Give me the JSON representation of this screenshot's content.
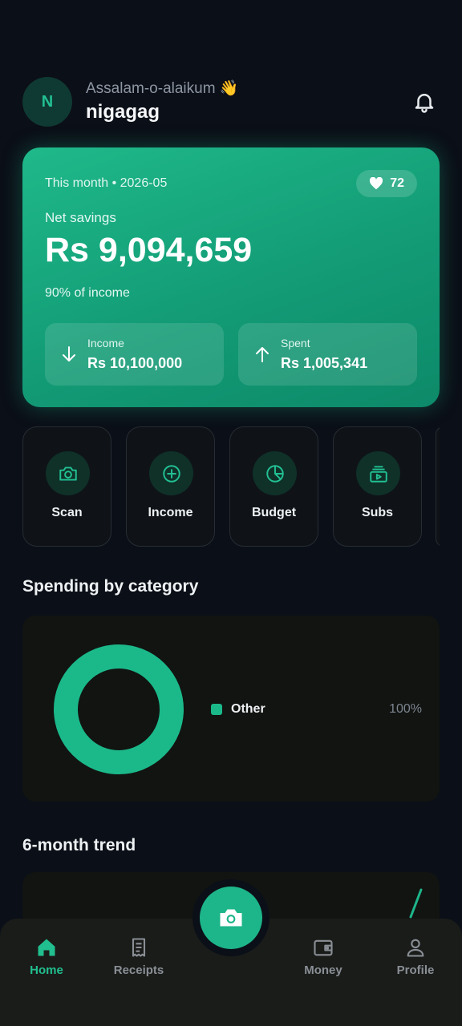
{
  "header": {
    "avatar_initial": "N",
    "greeting": "Assalam-o-alaikum 👋",
    "username": "nigagag"
  },
  "savings_card": {
    "period": "This month • 2026-05",
    "score": "72",
    "label": "Net savings",
    "amount": "Rs 9,094,659",
    "percent_of_income": "90% of income",
    "income_label": "Income",
    "income_value": "Rs 10,100,000",
    "spent_label": "Spent",
    "spent_value": "Rs 1,005,341"
  },
  "quick_actions": [
    {
      "label": "Scan",
      "icon": "camera-icon"
    },
    {
      "label": "Income",
      "icon": "plus-circle-icon"
    },
    {
      "label": "Budget",
      "icon": "pie-chart-icon"
    },
    {
      "label": "Subs",
      "icon": "subscriptions-icon"
    }
  ],
  "spending": {
    "title": "Spending by category",
    "legend": [
      {
        "name": "Other",
        "percent": "100%",
        "color": "#1bb98a"
      }
    ]
  },
  "chart_data": {
    "type": "pie",
    "categories": [
      "Other"
    ],
    "values": [
      100
    ],
    "title": ""
  },
  "trend": {
    "title": "6-month trend"
  },
  "bottom_nav": {
    "items": [
      {
        "label": "Home",
        "icon": "home-icon",
        "active": true
      },
      {
        "label": "Receipts",
        "icon": "receipt-icon",
        "active": false
      },
      {
        "label": "Money",
        "icon": "wallet-icon",
        "active": false
      },
      {
        "label": "Profile",
        "icon": "person-icon",
        "active": false
      }
    ],
    "fab_icon": "camera-icon"
  },
  "colors": {
    "accent": "#1db58a",
    "background": "#0b0f17"
  }
}
